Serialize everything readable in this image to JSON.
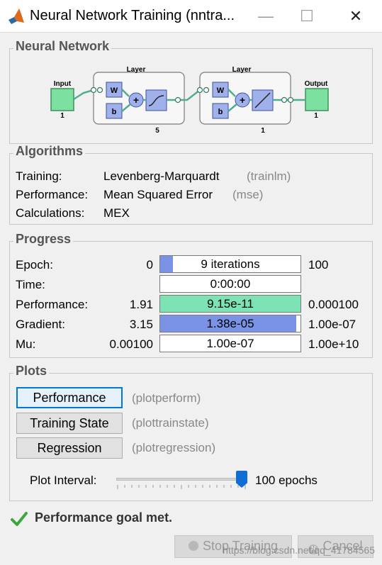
{
  "window": {
    "title": "Neural Network Training (nntra...",
    "minimize_glyph": "—",
    "maximize_glyph": "☐",
    "close_glyph": "✕"
  },
  "network": {
    "section_title": "Neural Network",
    "input_label": "Input",
    "input_size": "1",
    "hidden_layer_label": "Layer",
    "hidden_layer_size": "5",
    "output_layer_label": "Layer",
    "output_layer_size": "1",
    "output_label": "Output",
    "output_size": "1",
    "weight_label": "W",
    "bias_label": "b"
  },
  "algorithms": {
    "section_title": "Algorithms",
    "rows": [
      {
        "label": "Training:",
        "value": "Levenberg-Marquardt",
        "func": "(trainlm)"
      },
      {
        "label": "Performance:",
        "value": "Mean Squared Error",
        "func": "(mse)"
      },
      {
        "label": "Calculations:",
        "value": "MEX",
        "func": ""
      }
    ]
  },
  "progress": {
    "section_title": "Progress",
    "fill_colors": {
      "blue": "#7b93e6",
      "green": "#7de3b4"
    },
    "rows": [
      {
        "label": "Epoch:",
        "start": "0",
        "bar_text": "9 iterations",
        "end": "100",
        "fill_fraction": 0.09,
        "fill_color": "#7b93e6"
      },
      {
        "label": "Time:",
        "start": "",
        "bar_text": "0:00:00",
        "end": "",
        "fill_fraction": 0,
        "fill_color": "#7b93e6"
      },
      {
        "label": "Performance:",
        "start": "1.91",
        "bar_text": "9.15e-11",
        "end": "0.000100",
        "fill_fraction": 1.0,
        "fill_color": "#7de3b4"
      },
      {
        "label": "Gradient:",
        "start": "3.15",
        "bar_text": "1.38e-05",
        "end": "1.00e-07",
        "fill_fraction": 0.97,
        "fill_color": "#7b93e6"
      },
      {
        "label": "Mu:",
        "start": "0.00100",
        "bar_text": "1.00e-07",
        "end": "1.00e+10",
        "fill_fraction": 0,
        "fill_color": "#7b93e6"
      }
    ]
  },
  "plots": {
    "section_title": "Plots",
    "buttons": [
      {
        "label": "Performance",
        "func": "(plotperform)"
      },
      {
        "label": "Training State",
        "func": "(plottrainstate)"
      },
      {
        "label": "Regression",
        "func": "(plotregression)"
      }
    ],
    "interval_label": "Plot Interval:",
    "interval_value": "100 epochs",
    "slider_fraction": 1.0
  },
  "status": {
    "message": "Performance goal met.",
    "icon": "checkmark-icon"
  },
  "footer": {
    "stop_label": "Stop Training",
    "cancel_label": "Cancel",
    "watermark": "https://blog.csdn.net/qq_41784565"
  }
}
